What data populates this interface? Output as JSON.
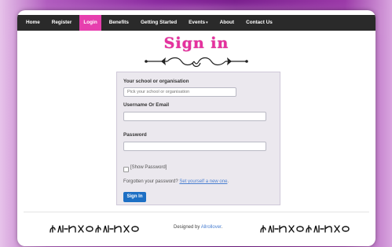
{
  "nav": {
    "items": [
      "Home",
      "Register",
      "Login",
      "Benefits",
      "Getting Started",
      "Events",
      "About",
      "Contact Us"
    ],
    "active": "Login"
  },
  "page": {
    "title": "Sign in"
  },
  "form": {
    "school_label": "Your school or organisation",
    "school_placeholder": "Pick your school or organisation",
    "username_label": "Username Or Email",
    "username_value": "",
    "password_label": "Password",
    "password_value": "",
    "show_password_label": "[Show Password]",
    "show_password_checked": false,
    "forgot_text": "Forgotten your password?",
    "forgot_link": "Set yourself a new one",
    "forgot_suffix": ".",
    "submit_label": "Sign In"
  },
  "footer": {
    "designed_by": "Designed by",
    "designer": "Allrollover",
    "suffix": "."
  },
  "colors": {
    "accent": "#e6309e",
    "navbar": "#2a2a2a",
    "button": "#1d6fc4",
    "link": "#4a7fd0"
  }
}
